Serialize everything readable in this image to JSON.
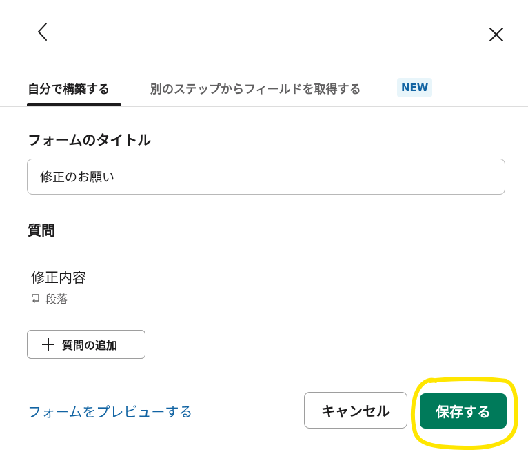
{
  "header": {
    "back_icon": "chevron-left-icon",
    "close_icon": "close-icon"
  },
  "tabs": [
    {
      "label": "自分で構築する",
      "active": true
    },
    {
      "label": "別のステップからフィールドを取得する",
      "active": false,
      "badge": "NEW"
    }
  ],
  "form": {
    "title_label": "フォームのタイトル",
    "title_value": "修正のお願い",
    "questions_label": "質問",
    "questions": [
      {
        "title": "修正内容",
        "type_icon": "paragraph-icon",
        "type_label": "段落"
      }
    ],
    "add_question_label": "質問の追加"
  },
  "footer": {
    "preview_label": "フォームをプレビューする",
    "cancel_label": "キャンセル",
    "save_label": "保存する"
  },
  "colors": {
    "accent_green": "#007a5a",
    "link_blue": "#1264a3",
    "badge_bg": "#e8f5fa",
    "highlight": "#ffe600"
  }
}
